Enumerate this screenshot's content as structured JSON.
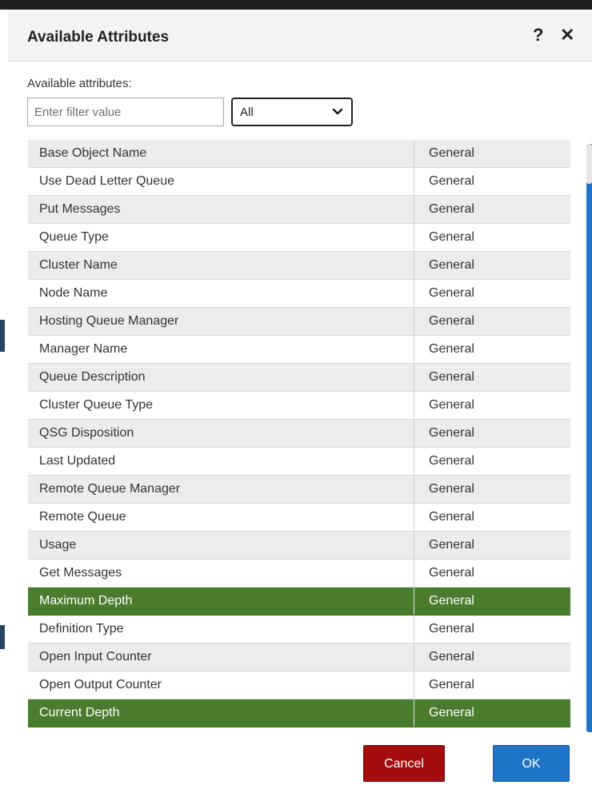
{
  "dialog": {
    "title": "Available Attributes",
    "help_icon": "?",
    "close_icon": "✕"
  },
  "filter": {
    "label": "Available attributes:",
    "placeholder": "Enter filter value",
    "select_value": "All"
  },
  "rows": [
    {
      "name": "Base Object Name",
      "category": "General",
      "selected": false
    },
    {
      "name": "Use Dead Letter Queue",
      "category": "General",
      "selected": false
    },
    {
      "name": "Put Messages",
      "category": "General",
      "selected": false
    },
    {
      "name": "Queue Type",
      "category": "General",
      "selected": false
    },
    {
      "name": "Cluster Name",
      "category": "General",
      "selected": false
    },
    {
      "name": "Node Name",
      "category": "General",
      "selected": false
    },
    {
      "name": "Hosting Queue Manager",
      "category": "General",
      "selected": false
    },
    {
      "name": "Manager Name",
      "category": "General",
      "selected": false
    },
    {
      "name": "Queue Description",
      "category": "General",
      "selected": false
    },
    {
      "name": "Cluster Queue Type",
      "category": "General",
      "selected": false
    },
    {
      "name": "QSG Disposition",
      "category": "General",
      "selected": false
    },
    {
      "name": "Last Updated",
      "category": "General",
      "selected": false
    },
    {
      "name": "Remote Queue Manager",
      "category": "General",
      "selected": false
    },
    {
      "name": "Remote Queue",
      "category": "General",
      "selected": false
    },
    {
      "name": "Usage",
      "category": "General",
      "selected": false
    },
    {
      "name": "Get Messages",
      "category": "General",
      "selected": false
    },
    {
      "name": "Maximum Depth",
      "category": "General",
      "selected": true
    },
    {
      "name": "Definition Type",
      "category": "General",
      "selected": false
    },
    {
      "name": "Open Input Counter",
      "category": "General",
      "selected": false
    },
    {
      "name": "Open Output Counter",
      "category": "General",
      "selected": false
    },
    {
      "name": "Current Depth",
      "category": "General",
      "selected": true
    }
  ],
  "buttons": {
    "cancel": "Cancel",
    "ok": "OK"
  },
  "colors": {
    "selected_row": "#4a7c2e",
    "cancel": "#a30d0d",
    "ok": "#1f74c8"
  }
}
